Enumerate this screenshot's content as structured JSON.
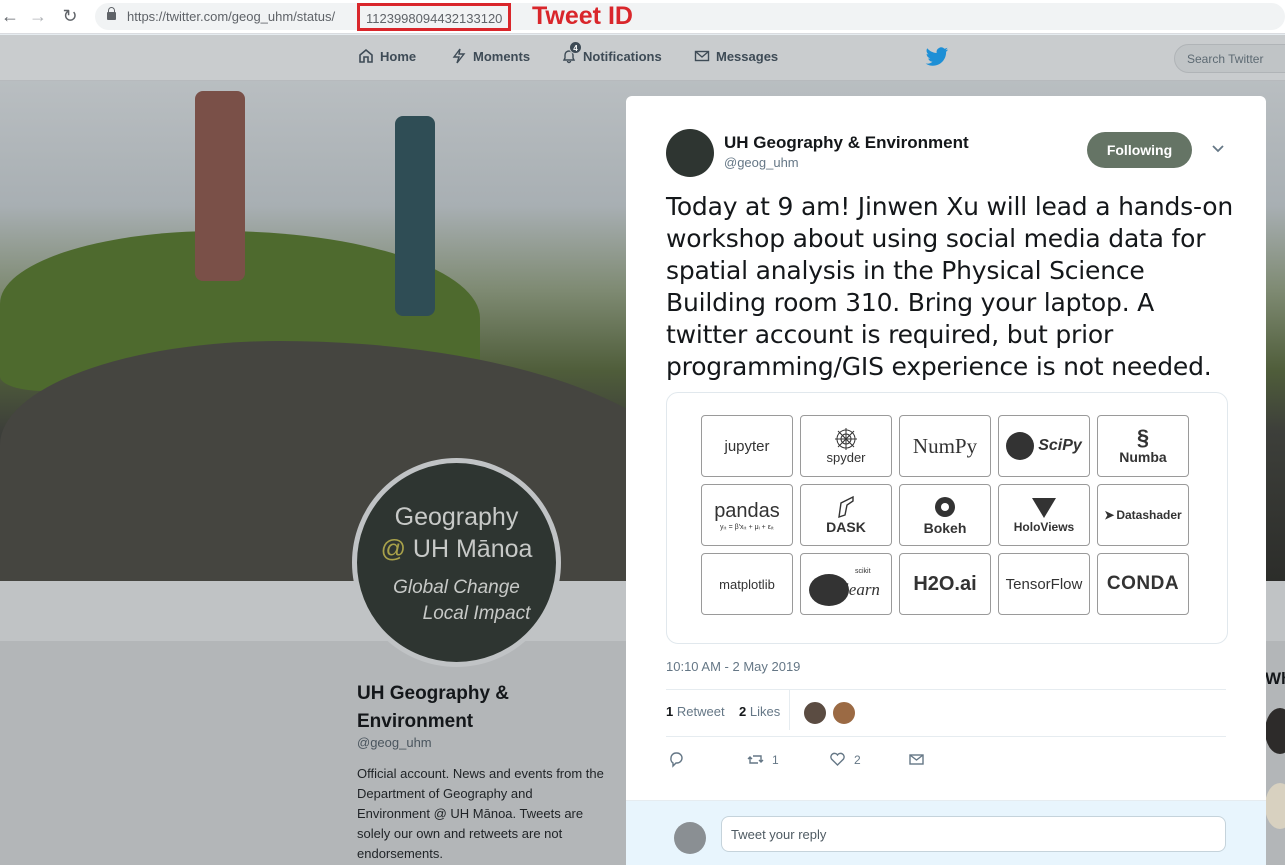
{
  "browser": {
    "url_prefix": "https://twitter.com/geog_uhm/status/",
    "tweet_id": "1123998094432133120",
    "annotation_label": "Tweet ID"
  },
  "header": {
    "nav": [
      {
        "label": "Home",
        "icon": "home-icon"
      },
      {
        "label": "Moments",
        "icon": "lightning-icon"
      },
      {
        "label": "Notifications",
        "icon": "bell-icon",
        "badge": "4"
      },
      {
        "label": "Messages",
        "icon": "envelope-icon"
      }
    ],
    "search_placeholder": "Search Twitter"
  },
  "profile": {
    "avatar_lines": [
      "Geography",
      "@",
      "UH Mānoa",
      "Global Change",
      "Local Impact"
    ],
    "name": "UH Geography & Environment",
    "handle": "@geog_uhm",
    "bio": "Official account. News and events from the Department of Geography and Environment @ UH Mānoa. Tweets are solely our own and retweets are not endorsements."
  },
  "sidebar_peek": {
    "text": "Wh"
  },
  "tweet": {
    "author_name": "UH Geography & Environment",
    "author_handle": "@geog_uhm",
    "follow_label": "Following",
    "text": "Today at 9 am! Jinwen Xu will lead a hands-on workshop about using social media data for spatial analysis in the Physical Science Building room 310. Bring your laptop. A twitter account is required, but prior programming/GIS experience is not needed.",
    "logos": [
      "jupyter",
      "spyder",
      "NumPy",
      "SciPy",
      "Numba",
      "pandas",
      "DASK",
      "Bokeh",
      "HoloViews",
      "Datashader",
      "matplotlib",
      "learn",
      "H2O.ai",
      "TensorFlow",
      "CONDA"
    ],
    "logo_extras": {
      "pandas_formula": "yᵢₜ = β′xᵢₜ + μᵢ + εᵢₜ",
      "sklearn_small": "scikit"
    },
    "timestamp": "10:10 AM - 2 May 2019",
    "retweets_count": "1",
    "retweets_label": "Retweet",
    "likes_count": "2",
    "likes_label": "Likes",
    "action_retweet_count": "1",
    "action_like_count": "2",
    "reply_placeholder": "Tweet your reply"
  },
  "colors": {
    "annotation": "#d9262b",
    "twitter_blue": "#1da1f2",
    "follow_button": "#657465"
  }
}
